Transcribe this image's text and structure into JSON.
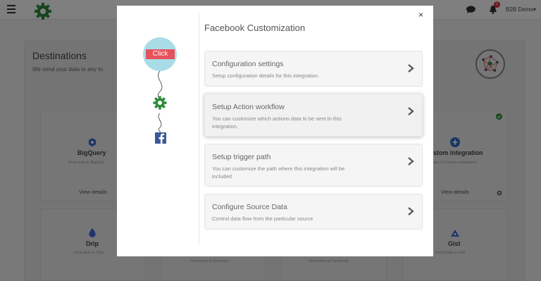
{
  "header": {
    "user_label": "B2B Demo",
    "notification_count": "1"
  },
  "background": {
    "title": "Destinations",
    "subtitle": "We send your data to any to",
    "cards": [
      {
        "name": "BigQuery",
        "desc": "Send data to BigQuer",
        "link": "View details"
      },
      {
        "name": "stom Integration",
        "desc": "ata to Custom Integration",
        "link": "View details"
      },
      {
        "name": "Drip",
        "desc": "Send data to Drip"
      },
      {
        "name": "Gist",
        "desc": "Send data to Gist"
      },
      {
        "desc": "Send data to Emarsys"
      },
      {
        "desc": "Send data to Facebook"
      }
    ]
  },
  "modal": {
    "title": "Facebook Customization",
    "close_label": "×",
    "click_label": "Click",
    "options": [
      {
        "title": "Configuration settings",
        "desc": "Setup configuration details for this integration."
      },
      {
        "title": "Setup Action workflow",
        "desc": "You can customize which actions data to be sent to this integration."
      },
      {
        "title": "Setup trigger path",
        "desc": "You can customize the path where this integration will be included."
      },
      {
        "title": "Configure Source Data",
        "desc": "Control data flow from the particular source"
      }
    ]
  },
  "colors": {
    "brand_green": "#2e8b3a",
    "click_red": "#e8505b",
    "facebook_blue": "#3b5998",
    "circle_blue": "#a8dde8"
  }
}
